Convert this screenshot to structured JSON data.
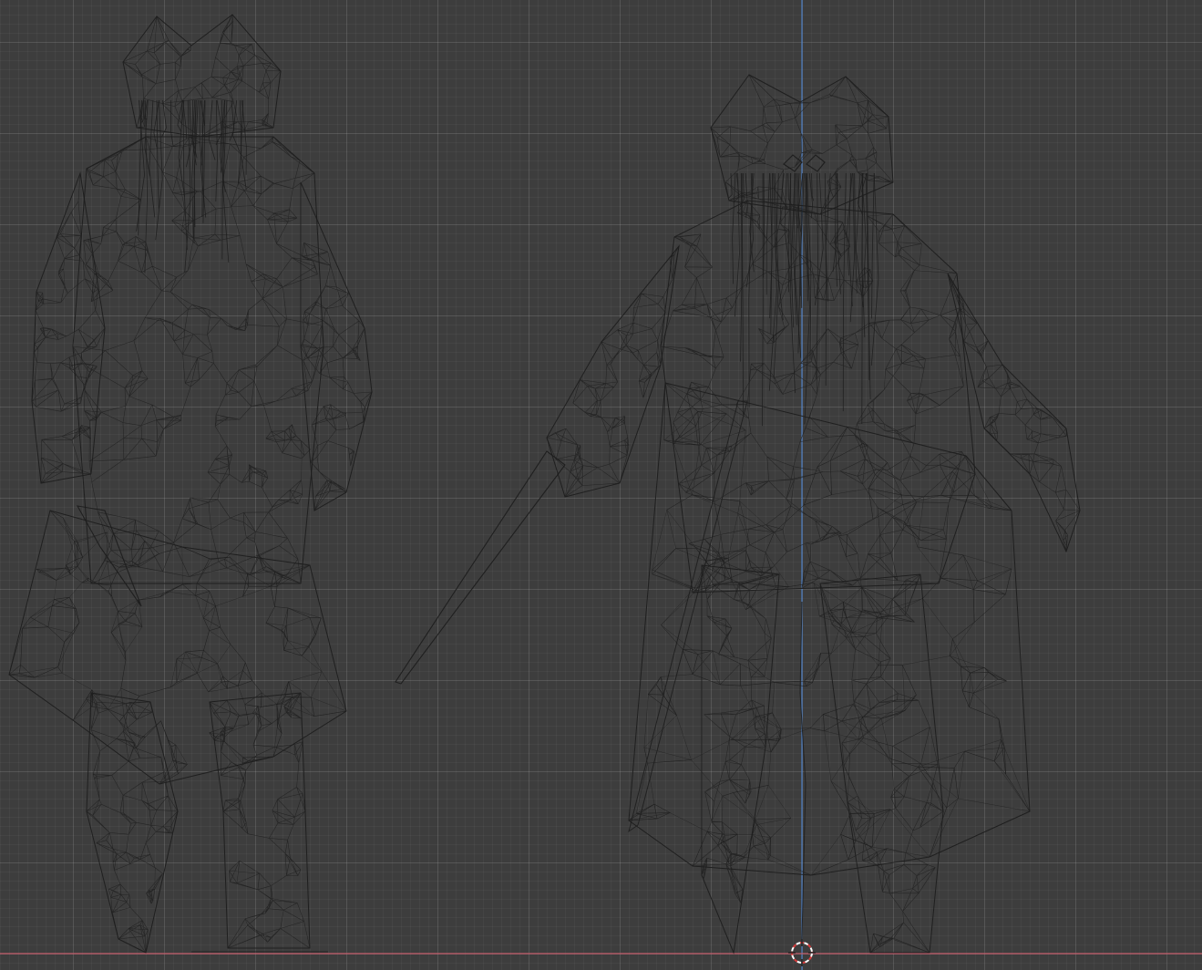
{
  "viewport": {
    "mode": "wireframe",
    "view": "front-orthographic",
    "background_color": "#3d3d3d",
    "grid_color": "#4a4a4a",
    "wire_color": "#1e1e1e",
    "axis_x_color": "#c25b6a",
    "axis_z_color": "#4d7fc4",
    "cursor_icon": "3d-cursor-icon"
  },
  "objects": [
    {
      "name_icon": "pirate-character-back-view"
    },
    {
      "name_icon": "pirate-character-front-view"
    }
  ]
}
